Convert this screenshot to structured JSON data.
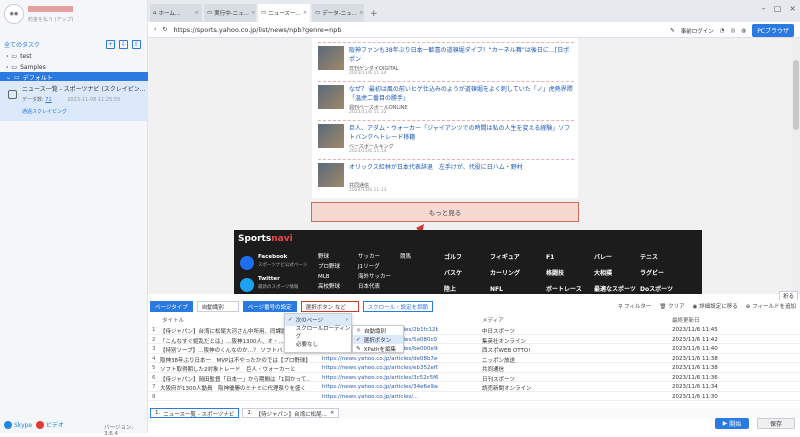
{
  "sidebar": {
    "account_sub": "料金を払う (アップ)",
    "all_tasks": "全てのタスク",
    "tree": [
      "test",
      "Samples",
      "デフォルト"
    ],
    "task": {
      "title": "ニュース一覧 - スポーツナビ (スクレイピン...",
      "count_label": "データ数:",
      "count": "71",
      "date": "2023-11-08 11:25:55",
      "status": "通過スクレイピング"
    },
    "footer": {
      "skype": "Skype",
      "video": "ビデオ",
      "version": "バージョン: 3.6.4"
    }
  },
  "browser": {
    "tabs": [
      "ホーム...",
      "実行中-ニュ...",
      "ニュース一...",
      "データ-ニュ..."
    ],
    "url": "https://sports.yahoo.co.jp/list/news/npb?genre=npb",
    "login": "事前ログイン",
    "pc_browser": "PCブラウザ"
  },
  "page": {
    "articles": [
      {
        "title": "阪神ファンも38年ぶり日本一歓喜の道頓堀ダイブ！“カーネル舞”は後日に…[日ポポン",
        "source": "日刊ゲンダイDIGITAL",
        "date": "2023/11/6 11:34"
      },
      {
        "title": "なぜ？ 最初は風の前いヒゲ仕込みのようが道頓堀をよく刺していた「ノ」虎熱界隈「温虎二番目の勝手」",
        "source": "週刊ベースボールONLINE",
        "date": "2023/11/6 11:32"
      },
      {
        "title": "巨人、アダム・ウォーカー「ジャイアンツでの時間は私の人生を変える経験」ソフトバンクへトレード移籍",
        "source": "ベースボールキング",
        "date": "2023/11/6 11:14"
      },
      {
        "title": "オリックス紅林が日本代表辞退　左手けが、代役に日ハム・野村",
        "source": "共同通信",
        "date": "2023/11/6 11:13"
      }
    ],
    "more": "もっと見る",
    "footer": {
      "logo_a": "Sports",
      "logo_b": "navi",
      "facebook": "Facebook",
      "facebook_sub": "スポーツナビ公式ページ",
      "twitter": "Twitter",
      "twitter_sub": "最新のスポーツ情報",
      "col1": [
        "野球",
        "プロ野球",
        "MLB",
        "高校野球",
        "社会人野球"
      ],
      "col2": [
        "サッカー",
        "J1リーグ",
        "海外サッカー",
        "日本代表"
      ],
      "col3": [
        "サッカー",
        "競馬"
      ],
      "col4": [
        "ゴルフ",
        "バスケ",
        "陸上"
      ],
      "col5": [
        "フィギュア",
        "カーリング",
        "NFL"
      ],
      "col6": [
        "F1",
        "格闘技",
        "ボートレース"
      ],
      "col7": [
        "バレー",
        "大相撲",
        "最適なスポーツ"
      ],
      "col8": [
        "テニス",
        "ラグビー",
        "Doスポーツ"
      ]
    }
  },
  "panel": {
    "toolbar": {
      "page_type": "ページタイプ",
      "auto_detect": "自動識別",
      "page_paging": "ページ番号の設定",
      "select_button": "選択ボタン など",
      "scroll_settings": "スクロール・設定を調節",
      "filter": "フィルター",
      "clear": "クリア",
      "detail": "詳細設定に移る",
      "add_field": "フィールドを追加",
      "collapse": "折る"
    },
    "menu": [
      "次のページ",
      "スクロールローディング",
      "必要なし"
    ],
    "submenu": [
      "自動識別",
      "選択ボタン",
      "XPathを編集"
    ],
    "columns": {
      "title": "タイトル",
      "url": "",
      "media": "メディア",
      "date": "最終更新日"
    },
    "rows": [
      {
        "n": "1",
        "title": "【侍ジャパン】台湾に松尾大河さん中所用、同課題ジ...",
        "url": "https://news.yahoo.co.jp/articles/2b1fc12b012023ae6610609...",
        "media": "中日スポーツ",
        "date": "2023/11/6 11:45"
      },
      {
        "n": "2",
        "title": "「こんなすぐ姫乱だとは」…阪神1300人、オ・...",
        "url": "https://news.yahoo.co.jp/articles/5a080c07058a742112f8ac44...",
        "media": "集英社オンライン",
        "date": "2023/11/6 11:42"
      },
      {
        "n": "3",
        "title": "【特別ソープ】…阪神のくんなのか…？ ソフトバン...",
        "url": "https://news.yahoo.co.jp/articles/be000e9006c3285f424c9d00d482...",
        "media": "西スポWEB OTTO!",
        "date": "2023/11/6 11:40"
      },
      {
        "n": "4",
        "title": "阪神38年ぶり日本一　MVPは不やったかのでは【プロ野球】...",
        "url": "https://news.yahoo.co.jp/articles/de08b7e6ba12e316db0e672db6b4a...",
        "media": "ニッポン放送",
        "date": "2023/11/6 11:38"
      },
      {
        "n": "5",
        "title": "ソフト取得期した2対象トレード　巨人・ウォーカーと",
        "url": "https://news.yahoo.co.jp/articles/eb352ef0e770b78e6aca011d05...",
        "media": "共同通信",
        "date": "2023/11/6 11:38"
      },
      {
        "n": "6",
        "title": "【侍ジャパン】岡田監督「日本一」から期間は「1回かって…",
        "url": "https://news.yahoo.co.jp/articles/3c52c5f6fe05549a92724e70...",
        "media": "日刊スポーツ",
        "date": "2023/11/6 11:36"
      },
      {
        "n": "7",
        "title": "大阪府が1300人動員　阪神優勝のミナミに代理祭りを盛く",
        "url": "https://news.yahoo.co.jp/articles/34e6e9ad5bd6ce276dd330ac3b75c5...",
        "media": "読売新聞オンライン",
        "date": "2023/11/6 11:34"
      },
      {
        "n": "8",
        "title": "",
        "url": "https://news.yahoo.co.jp/articles/...",
        "media": "",
        "date": "2023/11/6 11:30"
      }
    ],
    "bottom_tabs": [
      {
        "n": "1.",
        "label": "ニュース一覧 - スポーツナビ"
      },
      {
        "n": "2.",
        "label": "【侍ジャパン】台湾に松尾..."
      }
    ],
    "start": "開始",
    "save": "保存"
  }
}
